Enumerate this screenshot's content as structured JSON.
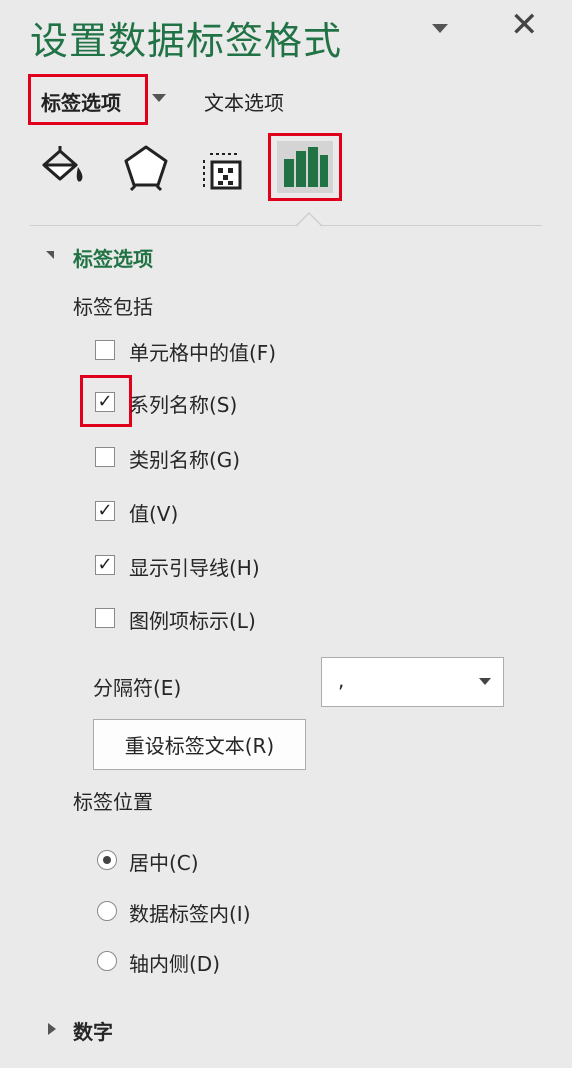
{
  "panel": {
    "title": "设置数据标签格式",
    "tabs": {
      "label_options": "标签选项",
      "text_options": "文本选项"
    },
    "icons": [
      "fill-line-icon",
      "effects-icon",
      "size-properties-icon",
      "label-options-icon"
    ],
    "accent_color": "#217346",
    "highlight_color": "#e0001b"
  },
  "label_section": {
    "heading": "标签选项",
    "contains_label": "标签包括",
    "checkboxes": [
      {
        "label": "单元格中的值(F)",
        "checked": false
      },
      {
        "label": "系列名称(S)",
        "checked": true
      },
      {
        "label": "类别名称(G)",
        "checked": false
      },
      {
        "label": "值(V)",
        "checked": true
      },
      {
        "label": "显示引导线(H)",
        "checked": true
      },
      {
        "label": "图例项标示(L)",
        "checked": false
      }
    ],
    "separator_label": "分隔符(E)",
    "separator_value": ",",
    "reset_button": "重设标签文本(R)",
    "position_label": "标签位置",
    "positions": [
      {
        "label": "居中(C)",
        "selected": true
      },
      {
        "label": "数据标签内(I)",
        "selected": false
      },
      {
        "label": "轴内侧(D)",
        "selected": false
      }
    ]
  },
  "number_section": {
    "heading": "数字"
  }
}
